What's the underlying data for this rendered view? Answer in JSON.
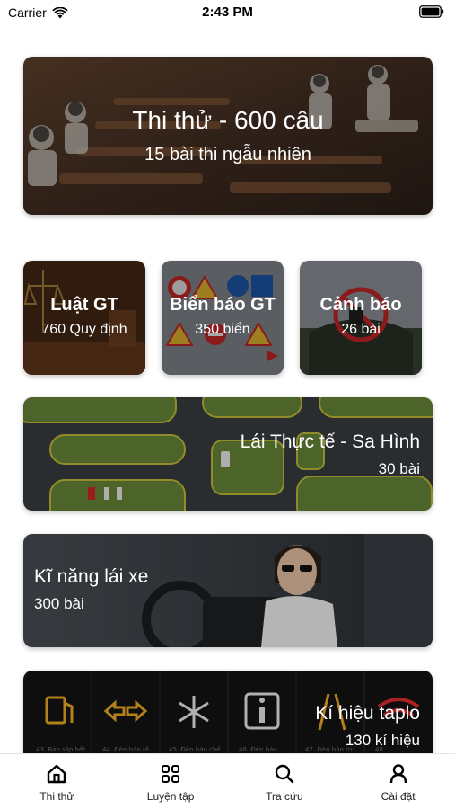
{
  "status_bar": {
    "carrier": "Carrier",
    "time": "2:43 PM"
  },
  "hero": {
    "title": "Thi thử - 600 câu",
    "subtitle": "15 bài thi ngẫu nhiên"
  },
  "categories": [
    {
      "title": "Luật GT",
      "subtitle": "760 Quy định"
    },
    {
      "title": "Biển báo GT",
      "subtitle": "350 biển"
    },
    {
      "title": "Cảnh báo",
      "subtitle": "26 bài"
    }
  ],
  "practice_driving": {
    "title": "Lái Thực tế - Sa Hình",
    "subtitle": "30 bài"
  },
  "driving_skills": {
    "title": "Kĩ năng lái xe",
    "subtitle": "300 bài"
  },
  "dashboard_symbols": {
    "title": "Kí hiệu taplo",
    "subtitle": "130 kí hiệu",
    "symbol_captions": [
      "43. Báo sắp hết",
      "44. Đèn báo rẽ",
      "45. Đèn báo chế",
      "46. Đèn báo",
      "47. Đèn báo trư",
      "48."
    ]
  },
  "tabs": [
    {
      "label": "Thi thử",
      "icon": "home-icon"
    },
    {
      "label": "Luyện tập",
      "icon": "grid-icon"
    },
    {
      "label": "Tra cứu",
      "icon": "search-icon"
    },
    {
      "label": "Cài đặt",
      "icon": "person-icon"
    }
  ],
  "colors": {
    "tab_active": "#000000",
    "dashboard_amber": "#e0a020",
    "warning_red": "#d62828"
  }
}
